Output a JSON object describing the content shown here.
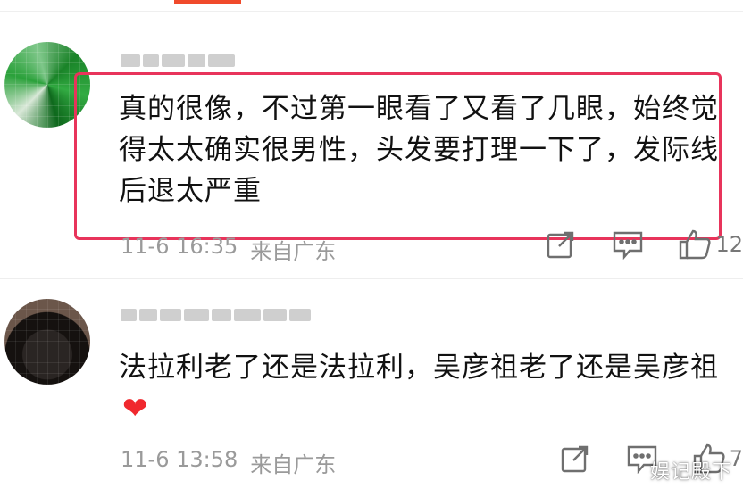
{
  "colors": {
    "accent": "#f04a2b",
    "highlight_border": "#e8345b",
    "heart": "#f0282e",
    "meta_text": "#9a9a9a"
  },
  "comments": [
    {
      "text": "真的很像，不过第一眼看了又看了几眼，始终觉得太太确实很男性，头发要打理一下了，发际线后退太严重",
      "time": "11-6 16:35",
      "location": "来自广东",
      "like_count": "12",
      "icons": {
        "share": "share-icon",
        "reply": "comment-icon",
        "like": "thumbs-up-icon"
      }
    },
    {
      "text": "法拉利老了还是法拉利，吴彦祖老了还是吴彦祖",
      "emoji": "❤",
      "time": "11-6 13:58",
      "location": "来自广东",
      "like_count": "7",
      "icons": {
        "share": "share-icon",
        "reply": "comment-icon",
        "like": "thumbs-up-icon"
      }
    }
  ],
  "watermark": "娱记殿下"
}
